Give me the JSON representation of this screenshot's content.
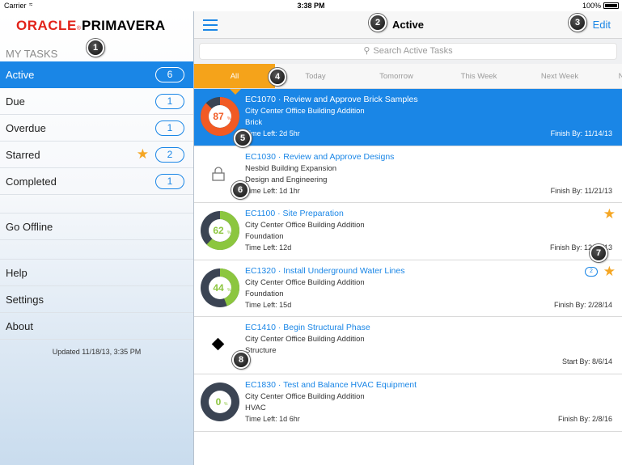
{
  "status_bar": {
    "carrier": "Carrier",
    "time": "3:38 PM",
    "battery": "100%"
  },
  "logo": {
    "oracle": "ORACLE",
    "product": "PRIMAVERA"
  },
  "sidebar": {
    "section_title": "MY TASKS",
    "items": [
      {
        "label": "Active",
        "count": "6"
      },
      {
        "label": "Due",
        "count": "1"
      },
      {
        "label": "Overdue",
        "count": "1"
      },
      {
        "label": "Starred",
        "count": "2"
      },
      {
        "label": "Completed",
        "count": "1"
      }
    ],
    "go_offline": "Go Offline",
    "help": "Help",
    "settings": "Settings",
    "about": "About",
    "updated": "Updated 11/18/13, 3:35 PM"
  },
  "header": {
    "title": "Active",
    "edit": "Edit"
  },
  "search": {
    "placeholder": "Search Active Tasks"
  },
  "filters": [
    "All",
    "Today",
    "Tomorrow",
    "This Week",
    "Next Week",
    "N"
  ],
  "tasks": [
    {
      "title": "EC1070 · Review and Approve Brick Samples",
      "project": "City Center Office Building Addition",
      "category": "Brick",
      "time_left": "Time Left: 2d 5hr",
      "finish": "Finish By: 11/14/13",
      "percent": 87,
      "percent_label": "87"
    },
    {
      "title": "EC1030 · Review and Approve Designs",
      "project": "Nesbid Building Expansion",
      "category": "Design and Engineering",
      "time_left": "Time Left: 1d 1hr",
      "finish": "Finish By: 11/21/13"
    },
    {
      "title": "EC1100 · Site Preparation",
      "project": "City Center Office Building Addition",
      "category": "Foundation",
      "time_left": "Time Left: 12d",
      "finish": "Finish By: 12/20/13",
      "percent": 62,
      "percent_label": "62"
    },
    {
      "title": "EC1320 · Install Underground Water Lines",
      "project": "City Center Office Building Addition",
      "category": "Foundation",
      "time_left": "Time Left: 15d",
      "finish": "Finish By: 2/28/14",
      "percent": 44,
      "percent_label": "44",
      "comments": "2"
    },
    {
      "title": "EC1410 · Begin Structural Phase",
      "project": "City Center Office Building Addition",
      "category": "Structure",
      "time_left": "",
      "finish": "Start By: 8/6/14"
    },
    {
      "title": "EC1830 · Test and Balance HVAC Equipment",
      "project": "City Center Office Building Addition",
      "category": "HVAC",
      "time_left": "Time Left: 1d 6hr",
      "finish": "Finish By: 2/8/16",
      "percent": 0,
      "percent_label": "0"
    }
  ],
  "percent_sign": "%",
  "callouts": [
    "1",
    "2",
    "3",
    "4",
    "5",
    "6",
    "7",
    "8"
  ],
  "colors": {
    "accent": "#1a86e6",
    "filter_active": "#f5a31a",
    "gauge_orange": "#f15a24",
    "gauge_green": "#8cc63f",
    "gauge_track": "#3b4453",
    "star": "#f5a623"
  }
}
